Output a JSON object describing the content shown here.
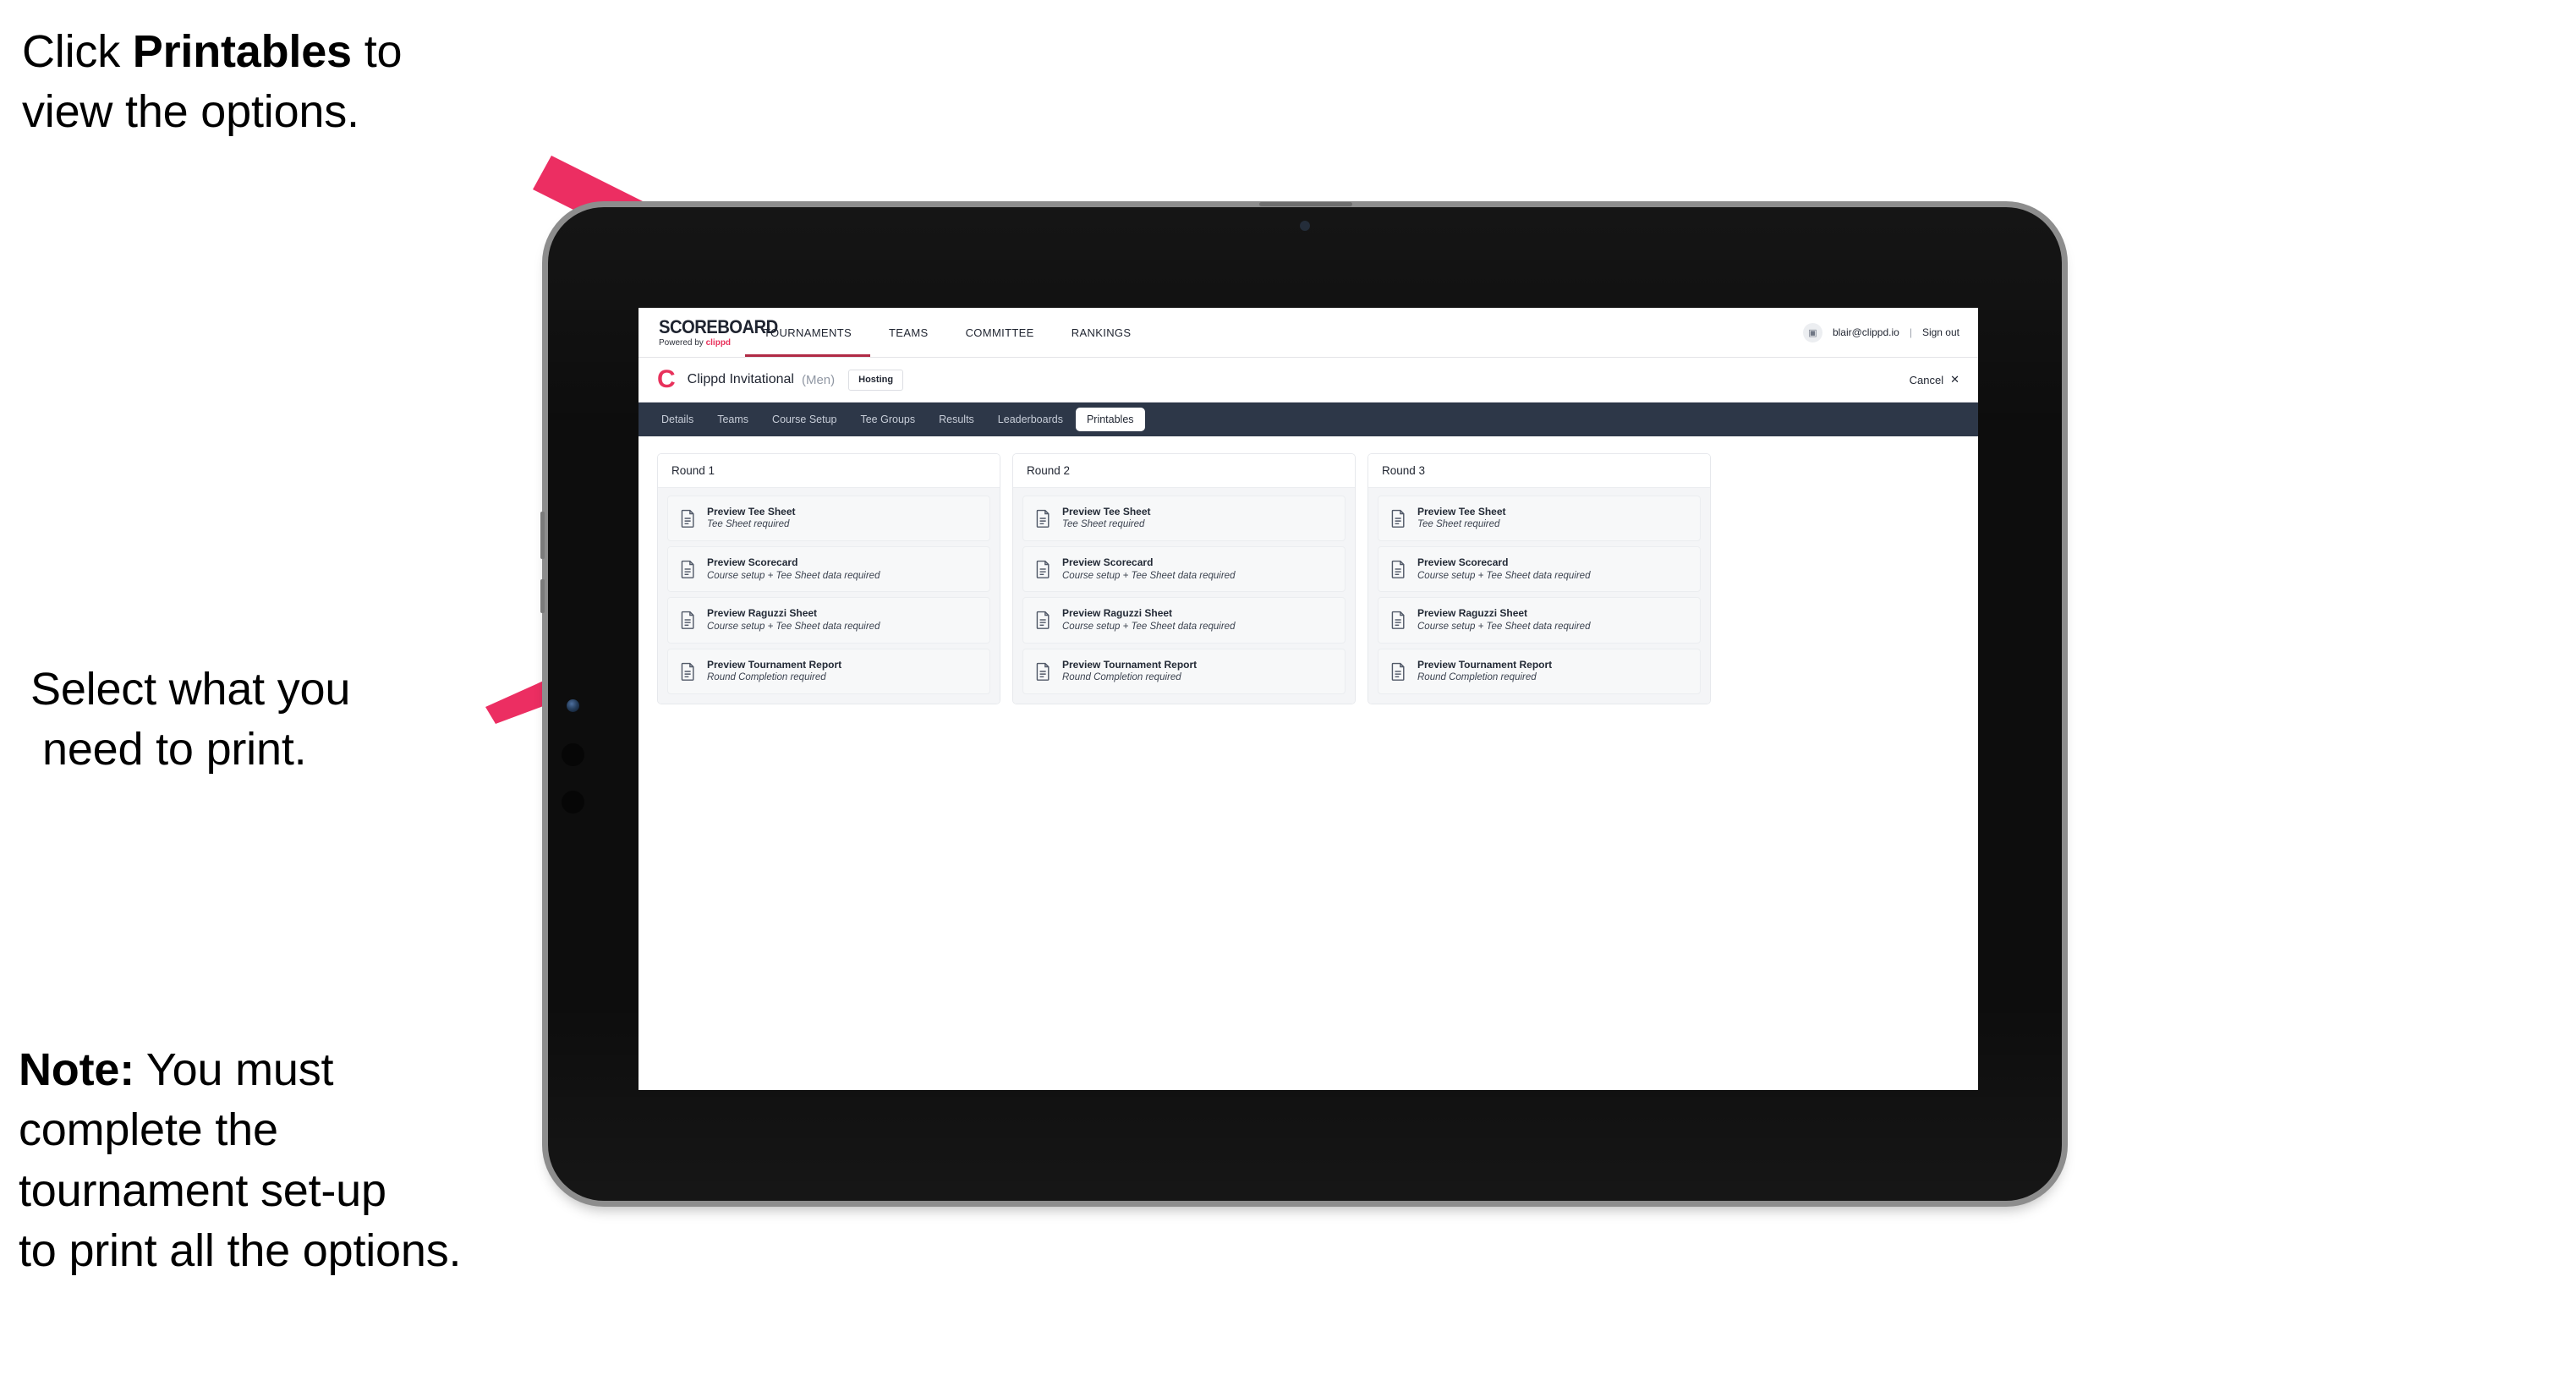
{
  "annotations": {
    "click_line1_pre": "Click ",
    "click_bold": "Printables",
    "click_line1_post": " to",
    "click_line2": "view the options.",
    "select_line1": "Select what you",
    "select_line2": "need to print.",
    "note_bold": "Note:",
    "note_line1_rest": " You must",
    "note_line2": "complete the",
    "note_line3": "tournament set-up",
    "note_line4": "to print all the options."
  },
  "colors": {
    "arrow_pink": "#ec2e62",
    "brand_pink": "#e8325c",
    "tabbar_navy": "#2d3748",
    "tournaments_underline": "#b02a45"
  },
  "app": {
    "brand": {
      "wordmark": "SCOREBOARD",
      "powered_prefix": "Powered by ",
      "powered_brand": "clippd"
    },
    "top_nav": [
      {
        "label": "TOURNAMENTS",
        "active": true
      },
      {
        "label": "TEAMS",
        "active": false
      },
      {
        "label": "COMMITTEE",
        "active": false
      },
      {
        "label": "RANKINGS",
        "active": false
      }
    ],
    "account": {
      "avatar_glyph": "▣",
      "email": "blair@clippd.io",
      "separator": "|",
      "sign_out": "Sign out"
    },
    "tournament_bar": {
      "logo_letter": "C",
      "name": "Clippd Invitational",
      "gender": "(Men)",
      "status_badge": "Hosting",
      "cancel_label": "Cancel",
      "cancel_glyph": "✕"
    },
    "section_tabs": [
      {
        "label": "Details",
        "active": false
      },
      {
        "label": "Teams",
        "active": false
      },
      {
        "label": "Course Setup",
        "active": false
      },
      {
        "label": "Tee Groups",
        "active": false
      },
      {
        "label": "Results",
        "active": false
      },
      {
        "label": "Leaderboards",
        "active": false
      },
      {
        "label": "Printables",
        "active": true
      }
    ],
    "rounds": [
      {
        "title": "Round 1",
        "items": [
          {
            "title": "Preview Tee Sheet",
            "subtitle": "Tee Sheet required"
          },
          {
            "title": "Preview Scorecard",
            "subtitle": "Course setup + Tee Sheet data required"
          },
          {
            "title": "Preview Raguzzi Sheet",
            "subtitle": "Course setup + Tee Sheet data required"
          },
          {
            "title": "Preview Tournament Report",
            "subtitle": "Round Completion required"
          }
        ]
      },
      {
        "title": "Round 2",
        "items": [
          {
            "title": "Preview Tee Sheet",
            "subtitle": "Tee Sheet required"
          },
          {
            "title": "Preview Scorecard",
            "subtitle": "Course setup + Tee Sheet data required"
          },
          {
            "title": "Preview Raguzzi Sheet",
            "subtitle": "Course setup + Tee Sheet data required"
          },
          {
            "title": "Preview Tournament Report",
            "subtitle": "Round Completion required"
          }
        ]
      },
      {
        "title": "Round 3",
        "items": [
          {
            "title": "Preview Tee Sheet",
            "subtitle": "Tee Sheet required"
          },
          {
            "title": "Preview Scorecard",
            "subtitle": "Course setup + Tee Sheet data required"
          },
          {
            "title": "Preview Raguzzi Sheet",
            "subtitle": "Course setup + Tee Sheet data required"
          },
          {
            "title": "Preview Tournament Report",
            "subtitle": "Round Completion required"
          }
        ]
      }
    ]
  }
}
